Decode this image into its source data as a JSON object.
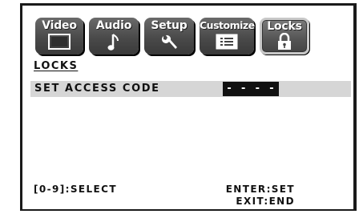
{
  "tabs": [
    {
      "label": "Video",
      "icon": "screen-icon"
    },
    {
      "label": "Audio",
      "icon": "music-note-icon"
    },
    {
      "label": "Setup",
      "icon": "wrench-icon"
    },
    {
      "label": "Customize",
      "icon": "list-icon"
    },
    {
      "label": "Locks",
      "icon": "padlock-icon",
      "active": true
    }
  ],
  "page": {
    "title": "LOCKS"
  },
  "access_code": {
    "label": "SET ACCESS CODE",
    "value": "- - - -"
  },
  "help": {
    "select": "[0-9]:SELECT",
    "enter": "ENTER:SET",
    "exit": "EXIT:END"
  },
  "colors": {
    "tab_bg": "#4a4a4a",
    "tab_active_border": "#c8c8c8",
    "row_highlight": "#d6d6d6",
    "code_box": "#111111"
  }
}
